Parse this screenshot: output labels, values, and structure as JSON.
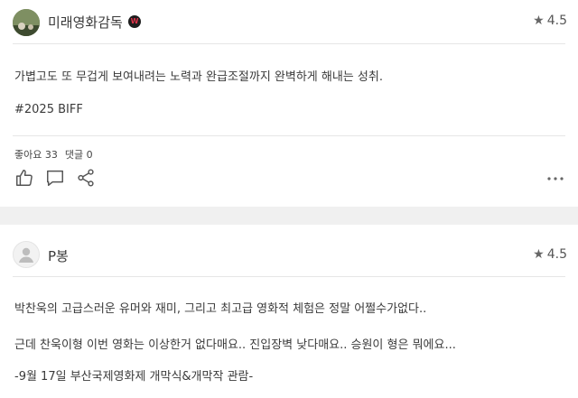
{
  "reviews": [
    {
      "user_name": "미래영화감독",
      "badge_text": "W",
      "rating": "4.5",
      "body_lines": [
        "가볍고도 또 무겁게 보여내려는 노력과 완급조절까지 완벽하게 해내는 성취.",
        "#2025 BIFF"
      ],
      "likes_label": "좋아요 33",
      "comments_label": "댓글 0",
      "icons": [
        "like-icon",
        "comment-icon",
        "share-icon",
        "more-icon"
      ]
    },
    {
      "user_name": "P봉",
      "rating": "4.5",
      "body_lines": [
        "박찬욱의 고급스러운 유머와 재미, 그리고 최고급 영화적 체험은 정말 어쩔수가없다..",
        "근데 찬욱이형 이번 영화는 이상한거 없다매요.. 진입장벽 낮다매요.. 승원이 형은 뭐에요...",
        "-9월 17일 부산국제영화제 개막식&개막작 관람-"
      ]
    }
  ],
  "colors": {
    "page_bg": "#f0f0f0",
    "card_bg": "#ffffff",
    "text": "#3a3a3a",
    "badge_bg": "#1e1e1e",
    "badge_fg": "#e0334a"
  }
}
